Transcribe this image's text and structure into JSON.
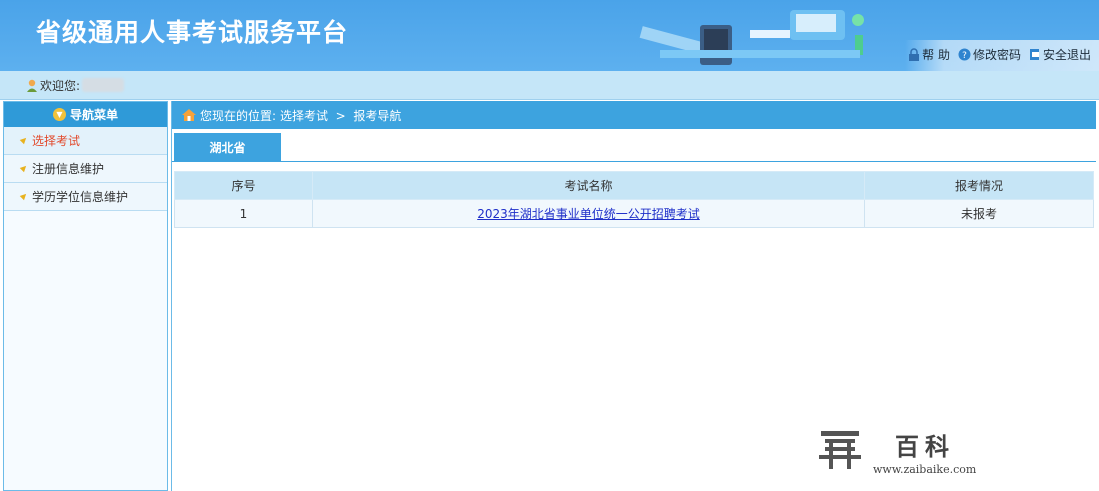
{
  "header": {
    "title": "省级通用人事考试服务平台",
    "links": [
      {
        "label": "帮 助",
        "icon": "lock-icon"
      },
      {
        "label": "修改密码",
        "icon": "help-icon"
      },
      {
        "label": "安全退出",
        "icon": "exit-icon"
      }
    ]
  },
  "welcome": {
    "label": "欢迎您:"
  },
  "sidebar": {
    "title": "导航菜单",
    "items": [
      {
        "label": "选择考试",
        "active": true
      },
      {
        "label": "注册信息维护",
        "active": false
      },
      {
        "label": "学历学位信息维护",
        "active": false
      }
    ]
  },
  "breadcrumb": {
    "prefix": "您现在的位置:",
    "path": "选择考试  >  报考导航"
  },
  "tab": {
    "label": "湖北省"
  },
  "table": {
    "headers": [
      "序号",
      "考试名称",
      "报考情况"
    ],
    "rows": [
      {
        "index": "1",
        "name": "2023年湖北省事业单位统一公开招聘考试",
        "status": "未报考"
      }
    ]
  },
  "watermark": {
    "text": "百科",
    "url": "www.zaibaike.com"
  },
  "colors": {
    "header_bg": "#4aa3e9",
    "accent": "#3da3df",
    "active_item": "#e24a2c",
    "link": "#1e2fc9"
  }
}
